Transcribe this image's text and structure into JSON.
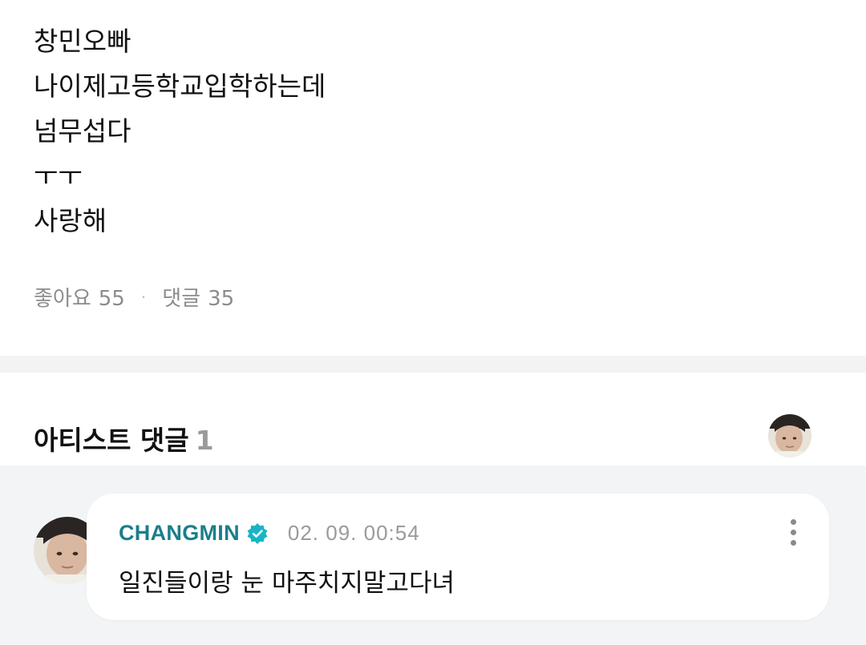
{
  "post": {
    "lines": [
      "창민오빠",
      "나이제고등학교입학하는데",
      "넘무섭다",
      "ㅜㅜ",
      "사랑해"
    ],
    "likes_label": "좋아요",
    "likes_count": "55",
    "separator": "·",
    "comments_label": "댓글",
    "comments_count": "35"
  },
  "artist_comments": {
    "title": "아티스트 댓글",
    "count": "1"
  },
  "comment": {
    "author": "CHANGMIN",
    "timestamp": "02. 09. 00:54",
    "text": "일진들이랑 눈 마주치지말고다녀"
  },
  "colors": {
    "author_name": "#1a7f8a",
    "verified_badge": "#17b5c4",
    "section_bg": "#f2f4f6"
  },
  "icons": [
    "verified-badge-icon",
    "more-options-icon",
    "avatar"
  ]
}
